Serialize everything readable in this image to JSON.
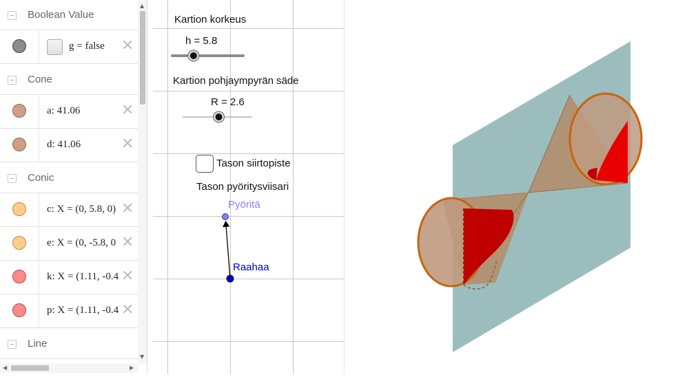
{
  "algebra": {
    "groups": [
      {
        "title": "Boolean Value",
        "items": [
          {
            "text": "g = false",
            "color": "#8c8c8c",
            "checkbox": true
          }
        ]
      },
      {
        "title": "Cone",
        "items": [
          {
            "text": "a: 41.06",
            "color": "#cf9f86"
          },
          {
            "text": "d: 41.06",
            "color": "#cf9f86"
          }
        ]
      },
      {
        "title": "Conic",
        "items": [
          {
            "text": "c: X = (0, 5.8, 0)",
            "color": "#ffcc8a"
          },
          {
            "text": "e: X = (0, -5.8, 0",
            "color": "#ffcc8a"
          },
          {
            "text": "k: X = (1.11, -0.4",
            "color": "#ff8a8a"
          },
          {
            "text": "p: X = (1.11, -0.4",
            "color": "#ff8a8a"
          }
        ]
      },
      {
        "title": "Line",
        "items": []
      }
    ],
    "delete_glyph": "✕",
    "scroll_up": "▲",
    "scroll_down": "▼",
    "scroll_left": "◀",
    "scroll_right": "▶"
  },
  "graphics": {
    "height_title": "Kartion korkeus",
    "height_value": "h = 5.8",
    "height_fraction": 0.3,
    "radius_title": "Kartion pohjaympyrän säde",
    "radius_value": "R = 2.6",
    "radius_fraction": 0.52,
    "checkbox_label": "Tason siirtopiste",
    "rotator_title": "Tason pyöritysviisari",
    "point_rotate": "Pyöritä",
    "point_drag": "Raahaa"
  },
  "colors": {
    "plane": "#9cbdbd",
    "cone": "#b48c68",
    "cone_edge": "#c8640a",
    "section": "#e00000",
    "point_blue": "#0000cc",
    "point_light": "#8080ff"
  }
}
